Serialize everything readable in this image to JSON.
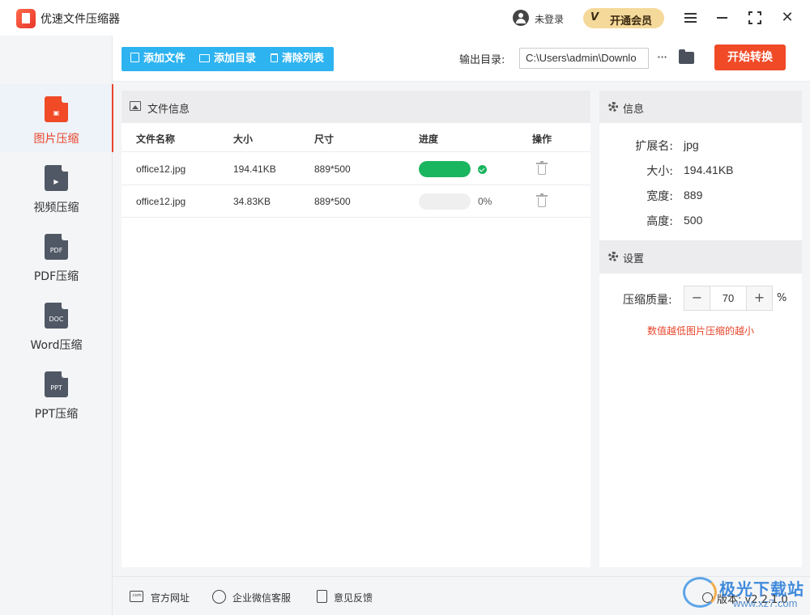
{
  "app": {
    "title": "优速文件压缩器"
  },
  "header": {
    "user_label": "未登录",
    "vip_badge": "V",
    "vip_label": "开通会员"
  },
  "sidebar": {
    "items": [
      {
        "label": "图片压缩",
        "glyph": "▣",
        "active": true
      },
      {
        "label": "视频压缩",
        "glyph": "▶",
        "active": false
      },
      {
        "label": "PDF压缩",
        "glyph": "PDF",
        "active": false
      },
      {
        "label": "Word压缩",
        "glyph": "DOC",
        "active": false
      },
      {
        "label": "PPT压缩",
        "glyph": "PPT",
        "active": false
      }
    ]
  },
  "toolbar": {
    "add_file": "添加文件",
    "add_folder": "添加目录",
    "clear_list": "清除列表",
    "output_label": "输出目录:",
    "output_path": "C:\\Users\\admin\\Downlo",
    "more": "···",
    "start": "开始转换"
  },
  "files": {
    "panel_title": "文件信息",
    "columns": {
      "name": "文件名称",
      "size": "大小",
      "dimensions": "尺寸",
      "progress": "进度",
      "action": "操作"
    },
    "rows": [
      {
        "name": "office12.jpg",
        "size": "194.41KB",
        "dimensions": "889*500",
        "progress": 1.0,
        "status": "done",
        "pct_text": ""
      },
      {
        "name": "office12.jpg",
        "size": "34.83KB",
        "dimensions": "889*500",
        "progress": 0.0,
        "status": "pending",
        "pct_text": "0%"
      }
    ]
  },
  "info": {
    "title": "信息",
    "ext_label": "扩展名:",
    "ext": "jpg",
    "size_label": "大小:",
    "size": "194.41KB",
    "width_label": "宽度:",
    "width": "889",
    "height_label": "高度:",
    "height": "500"
  },
  "settings": {
    "title": "设置",
    "quality_label": "压缩质量:",
    "minus": "−",
    "plus": "+",
    "quality": "70",
    "unit": "%",
    "hint": "数值越低图片压缩的越小"
  },
  "footer": {
    "website_icon": ".com",
    "website": "官方网址",
    "wechat": "企业微信客服",
    "feedback": "意见反馈",
    "version": "版本: v2.2.1.0"
  },
  "watermark": {
    "name": "极光下载站",
    "url": "www.xz7.com"
  },
  "colors": {
    "accent": "#f04a27",
    "toolbar_blue": "#2eb3f1",
    "progress_green": "#1ab55f"
  }
}
